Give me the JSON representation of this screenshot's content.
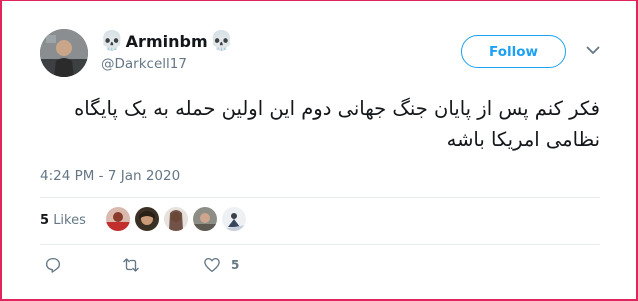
{
  "user": {
    "display_name": "Arminbm",
    "skull_left": "💀",
    "skull_right": "💀",
    "handle": "@Darkcell17",
    "avatar_icon": "profile-photo"
  },
  "header": {
    "follow_label": "Follow",
    "menu_icon": "chevron-down-icon"
  },
  "tweet": {
    "text": "فکر کنم پس از پایان جنگ جهانی دوم این اولین حمله به یک پایگاه نظامی امریکا باشه",
    "timestamp": "4:24 PM - 7 Jan 2020"
  },
  "stats": {
    "likes_count": "5",
    "likes_label": "Likes"
  },
  "actions": {
    "reply_icon": "reply-icon",
    "retweet_icon": "retweet-icon",
    "like_icon": "heart-icon",
    "like_count": "5"
  },
  "colors": {
    "accent": "#1da1f2",
    "secondary_text": "#657786",
    "frame": "#e0245e"
  }
}
